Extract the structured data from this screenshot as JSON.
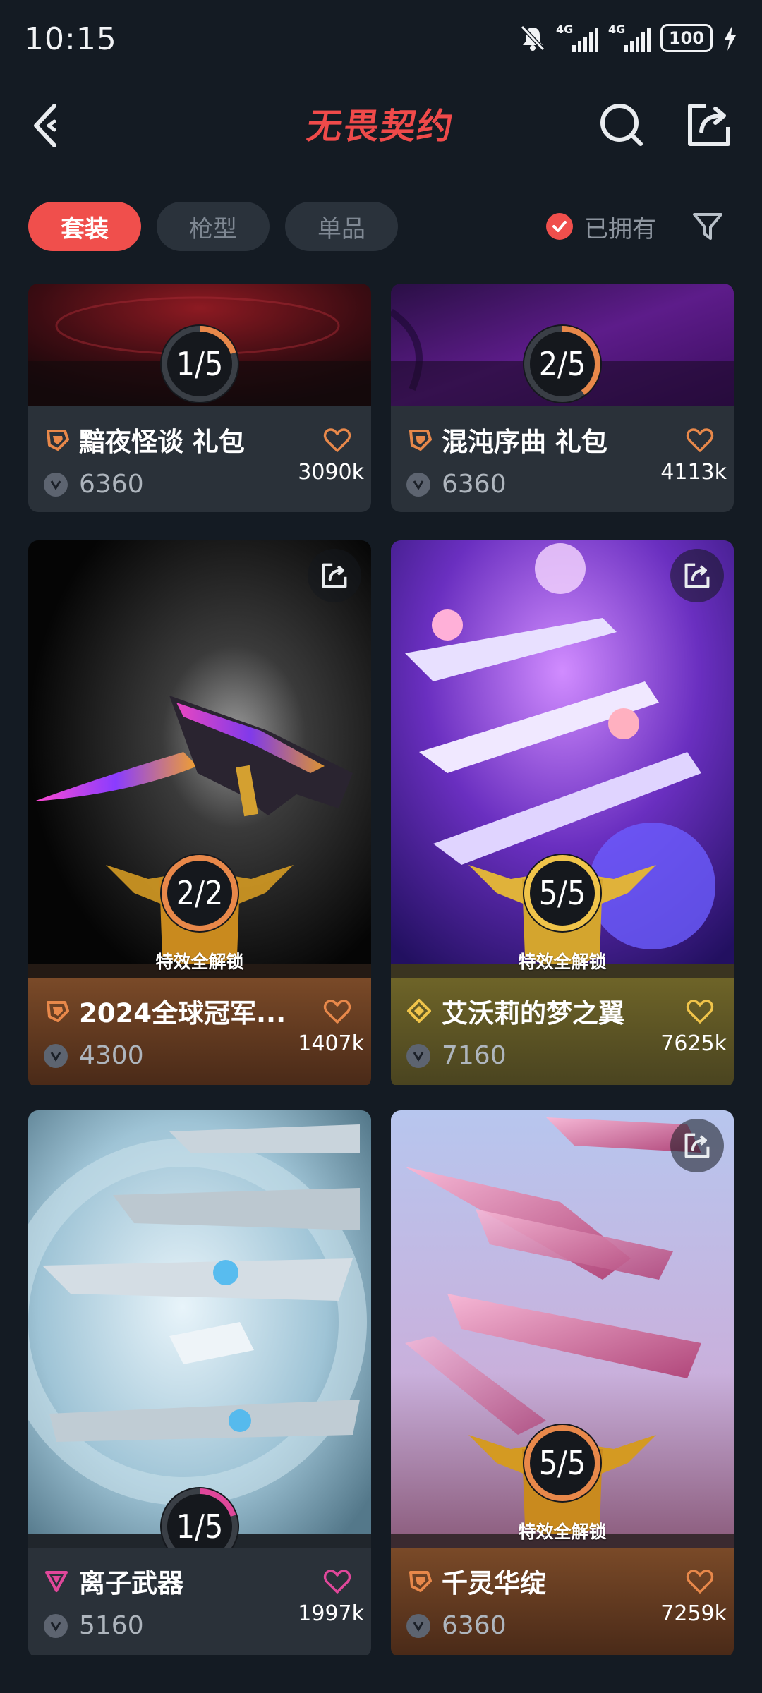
{
  "status_bar": {
    "time": "10:15",
    "network_1": "4G",
    "network_2": "4G",
    "battery": "100"
  },
  "header": {
    "title": "无畏契约",
    "brand_color": "#ef4a4a"
  },
  "filters": {
    "tabs": [
      {
        "label": "套装",
        "active": true
      },
      {
        "label": "枪型",
        "active": false
      },
      {
        "label": "单品",
        "active": false
      }
    ],
    "owned_label": "已拥有",
    "owned_checked": true,
    "accent_color": "#f04f4c"
  },
  "cards": [
    {
      "name": "黯夜怪谈 礼包",
      "price": "6360",
      "likes": "3090k",
      "progress": "1/5",
      "progress_fraction": 0.2,
      "tier_icon": "premium-edition-icon",
      "tier_color": "#e8884a"
    },
    {
      "name": "混沌序曲 礼包",
      "price": "6360",
      "likes": "4113k",
      "progress": "2/5",
      "progress_fraction": 0.4,
      "tier_icon": "premium-edition-icon",
      "tier_color": "#e8884a"
    },
    {
      "name": "2024全球冠军...",
      "price": "4300",
      "likes": "1407k",
      "progress": "2/2",
      "progress_fraction": 1.0,
      "badge": "特效全解锁",
      "tier_icon": "premium-edition-icon",
      "tier_color": "#e8884a"
    },
    {
      "name": "艾沃莉的梦之翼",
      "price": "7160",
      "likes": "7625k",
      "progress": "5/5",
      "progress_fraction": 1.0,
      "badge": "特效全解锁",
      "tier_icon": "exclusive-edition-icon",
      "tier_color": "#f0c44a"
    },
    {
      "name": "离子武器",
      "price": "5160",
      "likes": "1997k",
      "progress": "1/5",
      "progress_fraction": 0.2,
      "tier_icon": "ultra-edition-icon",
      "tier_color": "#e0479a"
    },
    {
      "name": "千灵华绽",
      "price": "6360",
      "likes": "7259k",
      "progress": "5/5",
      "progress_fraction": 1.0,
      "badge": "特效全解锁",
      "tier_icon": "premium-edition-icon",
      "tier_color": "#e8884a"
    }
  ]
}
